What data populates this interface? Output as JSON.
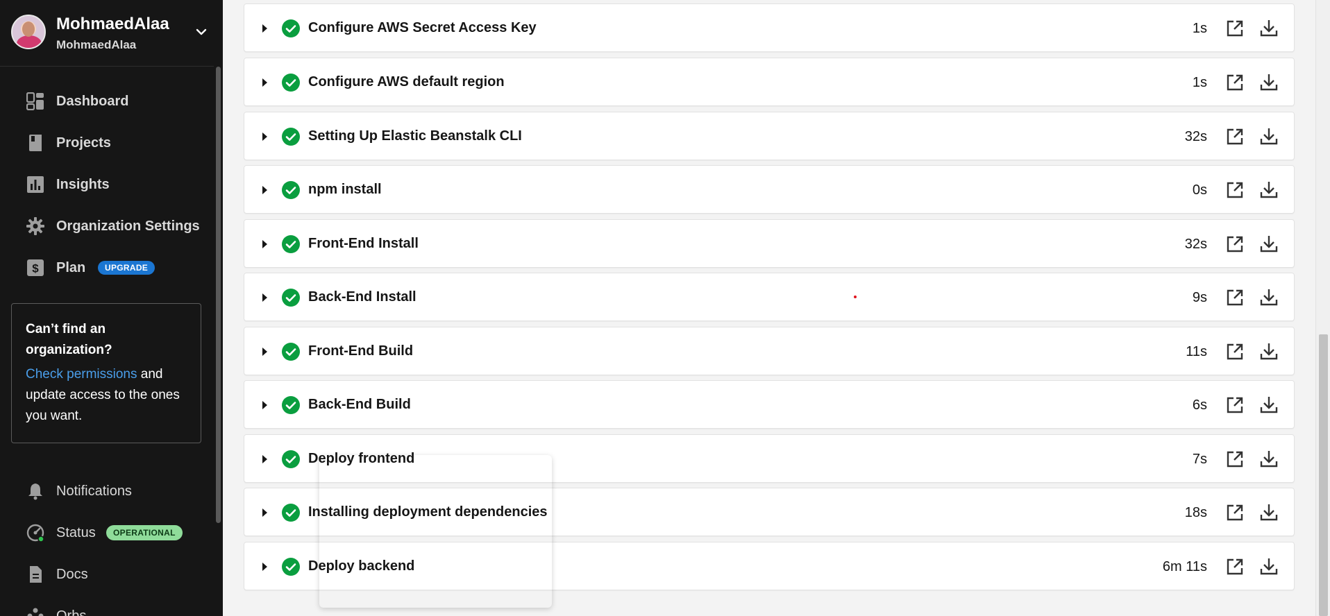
{
  "org": {
    "name": "MohmaedAlaa",
    "subtitle": "MohmaedAlaa"
  },
  "nav": {
    "dashboard": "Dashboard",
    "projects": "Projects",
    "insights": "Insights",
    "org_settings": "Organization Settings",
    "plan": "Plan",
    "plan_badge": "UPGRADE",
    "notifications": "Notifications",
    "status": "Status",
    "status_badge": "OPERATIONAL",
    "docs": "Docs",
    "orbs": "Orbs"
  },
  "org_box": {
    "title": "Can’t find an organization?",
    "link": "Check permissions",
    "text": " and update access to the ones you want."
  },
  "steps": [
    {
      "name": "Configure AWS Secret Access Key",
      "duration": "1s"
    },
    {
      "name": "Configure AWS default region",
      "duration": "1s"
    },
    {
      "name": "Setting Up Elastic Beanstalk CLI",
      "duration": "32s"
    },
    {
      "name": "npm install",
      "duration": "0s"
    },
    {
      "name": "Front-End Install",
      "duration": "32s"
    },
    {
      "name": "Back-End Install",
      "duration": "9s"
    },
    {
      "name": "Front-End Build",
      "duration": "11s"
    },
    {
      "name": "Back-End Build",
      "duration": "6s"
    },
    {
      "name": "Deploy frontend",
      "duration": "7s"
    },
    {
      "name": "Installing deployment dependencies",
      "duration": "18s"
    },
    {
      "name": "Deploy backend",
      "duration": "6m 11s"
    }
  ],
  "colors": {
    "success": "#0a9e3f",
    "link": "#4a9eea",
    "upgrade_badge": "#1b76d2",
    "operational_badge": "#8fdc9a"
  }
}
